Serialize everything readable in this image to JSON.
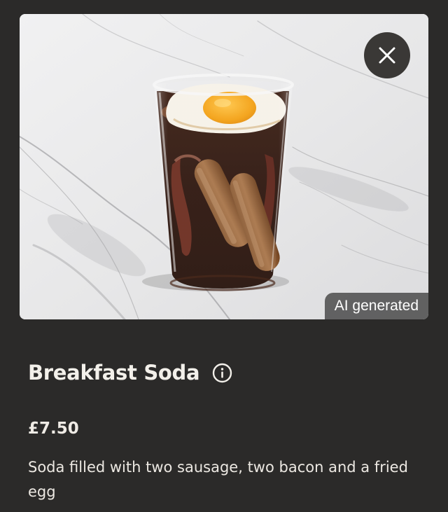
{
  "product": {
    "title": "Breakfast Soda",
    "price": "£7.50",
    "description": "Soda filled with two sausage, two bacon and a fried egg",
    "image_badge": "AI generated"
  },
  "icons": {
    "close": "close-icon",
    "info": "info-icon"
  },
  "colors": {
    "background": "#2b2a29",
    "text": "#f2efe9",
    "badge_bg": "#464646",
    "close_bg": "#3a3836"
  }
}
